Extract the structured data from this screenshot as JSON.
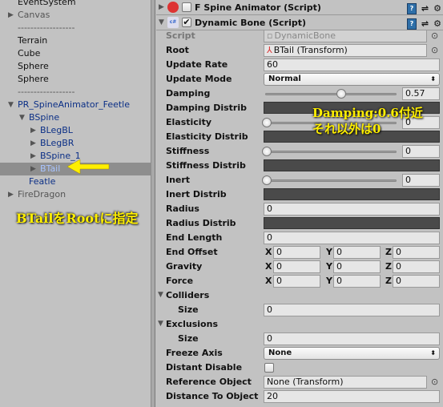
{
  "hierarchy": {
    "items": [
      {
        "label": "EventSystem",
        "indent": 0,
        "arrow": false,
        "color": "normal"
      },
      {
        "label": "Canvas",
        "indent": 0,
        "arrow": "right",
        "color": "gray"
      },
      {
        "label": "------------------",
        "indent": 0,
        "arrow": false,
        "color": "gray"
      },
      {
        "label": "Terrain",
        "indent": 0,
        "arrow": false,
        "color": "normal"
      },
      {
        "label": "Cube",
        "indent": 0,
        "arrow": false,
        "color": "normal"
      },
      {
        "label": "Sphere",
        "indent": 0,
        "arrow": false,
        "color": "normal"
      },
      {
        "label": "Sphere",
        "indent": 0,
        "arrow": false,
        "color": "normal"
      },
      {
        "label": "------------------",
        "indent": 0,
        "arrow": false,
        "color": "gray"
      },
      {
        "label": "PR_SpineAnimator_Feetle",
        "indent": 0,
        "arrow": "down",
        "color": "blue"
      },
      {
        "label": "BSpine",
        "indent": 1,
        "arrow": "down",
        "color": "blue"
      },
      {
        "label": "BLegBL",
        "indent": 2,
        "arrow": "right",
        "color": "blue"
      },
      {
        "label": "BLegBR",
        "indent": 2,
        "arrow": "right",
        "color": "blue"
      },
      {
        "label": "BSpine_1",
        "indent": 2,
        "arrow": "right",
        "color": "blue"
      },
      {
        "label": "BTail",
        "indent": 2,
        "arrow": "right",
        "color": "selblue",
        "selected": true
      },
      {
        "label": "Featle",
        "indent": 1,
        "arrow": false,
        "color": "blue"
      },
      {
        "label": "FireDragon",
        "indent": 0,
        "arrow": "right",
        "color": "gray"
      }
    ],
    "annotation": "BTailをRootに指定"
  },
  "inspector": {
    "components": [
      {
        "title": "F Spine Animator (Script)",
        "enabled": false,
        "expanded": false,
        "icon": "spine-animator-icon"
      },
      {
        "title": "Dynamic Bone (Script)",
        "enabled": true,
        "expanded": true,
        "icon": "csharp-script-icon"
      }
    ],
    "annotation_line1": "Damping:0.6付近",
    "annotation_line2": "それ以外は0",
    "rows": [
      {
        "label": "Script",
        "type": "object",
        "value": "DynamicBone",
        "disabled": true
      },
      {
        "label": "Root",
        "type": "object",
        "value": "BTail (Transform)",
        "icon": "transform-icon"
      },
      {
        "label": "Update Rate",
        "type": "field",
        "value": "60"
      },
      {
        "label": "Update Mode",
        "type": "dropdown",
        "value": "Normal"
      },
      {
        "label": "Damping",
        "type": "slider",
        "value": "0.57",
        "fraction": 0.57
      },
      {
        "label": "Damping Distrib",
        "type": "curve"
      },
      {
        "label": "Elasticity",
        "type": "slider",
        "value": "0",
        "fraction": 0
      },
      {
        "label": "Elasticity Distrib",
        "type": "curve"
      },
      {
        "label": "Stiffness",
        "type": "slider",
        "value": "0",
        "fraction": 0
      },
      {
        "label": "Stiffness Distrib",
        "type": "curve"
      },
      {
        "label": "Inert",
        "type": "slider",
        "value": "0",
        "fraction": 0
      },
      {
        "label": "Inert Distrib",
        "type": "curve"
      },
      {
        "label": "Radius",
        "type": "field",
        "value": "0"
      },
      {
        "label": "Radius Distrib",
        "type": "curve"
      },
      {
        "label": "End Length",
        "type": "field",
        "value": "0"
      },
      {
        "label": "End Offset",
        "type": "vector",
        "x": "0",
        "y": "0",
        "z": "0"
      },
      {
        "label": "Gravity",
        "type": "vector",
        "x": "0",
        "y": "0",
        "z": "0"
      },
      {
        "label": "Force",
        "type": "vector",
        "x": "0",
        "y": "0",
        "z": "0"
      },
      {
        "label": "Colliders",
        "type": "foldout"
      },
      {
        "label": "Size",
        "type": "field",
        "value": "0",
        "indent": true
      },
      {
        "label": "Exclusions",
        "type": "foldout"
      },
      {
        "label": "Size",
        "type": "field",
        "value": "0",
        "indent": true
      },
      {
        "label": "Freeze Axis",
        "type": "dropdown",
        "value": "None"
      },
      {
        "label": "Distant Disable",
        "type": "checkbox",
        "checked": false
      },
      {
        "label": "Reference Object",
        "type": "object",
        "value": "None (Transform)"
      },
      {
        "label": "Distance To Object",
        "type": "field",
        "value": "20"
      }
    ],
    "axis_labels": {
      "x": "X",
      "y": "Y",
      "z": "Z"
    }
  },
  "colors": {
    "annotation": "#ffef00",
    "selection": "#8e8e8e",
    "curve": "#4a4a4a"
  }
}
